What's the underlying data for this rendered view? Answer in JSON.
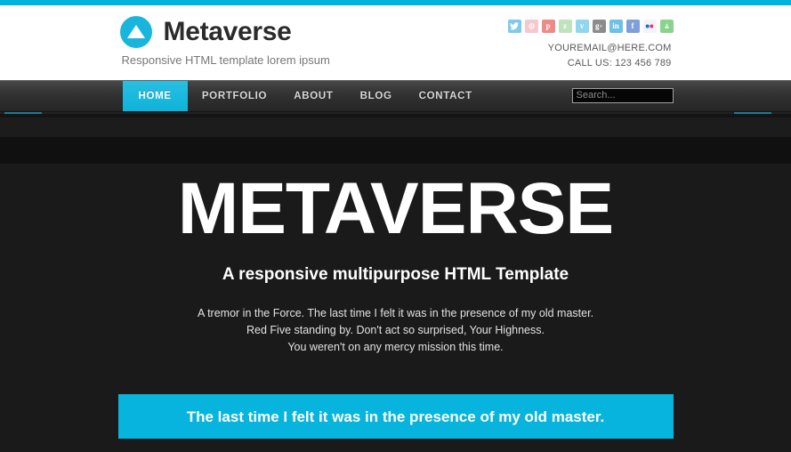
{
  "theme": {
    "accent": "#00b3dc",
    "header_bg": "#ffffff",
    "page_bg": "#1a1a1a",
    "nav_active_bg": "#0fb3da"
  },
  "brand": {
    "logo_icon": "triangle-in-circle-logo",
    "name": "Metaverse",
    "tagline": "Responsive HTML template lorem ipsum"
  },
  "social": [
    {
      "name": "twitter",
      "glyph": "t",
      "color": "#7ec9ee"
    },
    {
      "name": "instagram",
      "glyph": "o",
      "color": "#f5c7cf"
    },
    {
      "name": "pinterest",
      "glyph": "p",
      "color": "#f08a86"
    },
    {
      "name": "zerply",
      "glyph": "z",
      "color": "#bfe3bd"
    },
    {
      "name": "vimeo",
      "glyph": "v",
      "color": "#8fd6ef"
    },
    {
      "name": "googleplus",
      "glyph": "g",
      "color": "#8c8c8c"
    },
    {
      "name": "linkedin",
      "glyph": "in",
      "color": "#6cc2e6"
    },
    {
      "name": "facebook",
      "glyph": "f",
      "color": "#7e9ede"
    },
    {
      "name": "flickr",
      "glyph": "..",
      "color": "#f4f4f4"
    },
    {
      "name": "android",
      "glyph": "A",
      "color": "#8ad38b"
    }
  ],
  "contact": {
    "email": "YOUREMAIL@HERE.COM",
    "phone": "CALL US: 123 456 789"
  },
  "nav": {
    "items": [
      {
        "label": "HOME",
        "active": true
      },
      {
        "label": "PORTFOLIO",
        "active": false
      },
      {
        "label": "ABOUT",
        "active": false
      },
      {
        "label": "BLOG",
        "active": false
      },
      {
        "label": "CONTACT",
        "active": false
      }
    ],
    "search": {
      "placeholder": "Search...",
      "value": ""
    }
  },
  "hero": {
    "title": "METAVERSE",
    "subtitle": "A responsive multipurpose HTML Template",
    "lines": [
      "A tremor in the Force. The last time I felt it was in the presence of my old master.",
      "Red Five standing by. Don't act so surprised, Your Highness.",
      "You weren't on any mercy mission this time."
    ]
  },
  "callout": {
    "text": "The last time I felt it was in the presence of my old master."
  }
}
